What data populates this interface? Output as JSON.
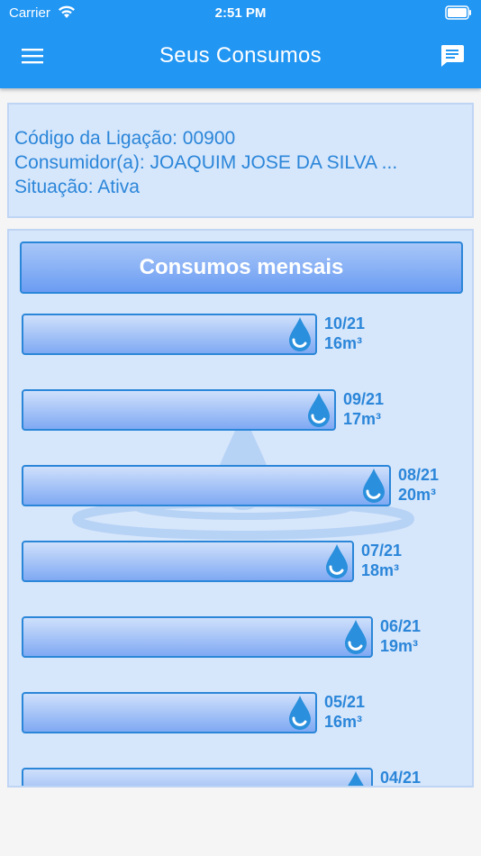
{
  "status_bar": {
    "carrier": "Carrier",
    "time": "2:51 PM"
  },
  "header": {
    "title": "Seus Consumos",
    "menu_icon": "menu-icon",
    "chat_icon": "chat-icon"
  },
  "info": {
    "codigo": "Código da Ligação: 00900",
    "consumidor": "Consumidor(a): JOAQUIM JOSE DA SILVA ...",
    "situacao": "Situação: Ativa"
  },
  "panel": {
    "title": "Consumos mensais",
    "months": [
      {
        "month": "10/21",
        "volume": "16m³",
        "value": 16
      },
      {
        "month": "09/21",
        "volume": "17m³",
        "value": 17
      },
      {
        "month": "08/21",
        "volume": "20m³",
        "value": 20
      },
      {
        "month": "07/21",
        "volume": "18m³",
        "value": 18
      },
      {
        "month": "06/21",
        "volume": "19m³",
        "value": 19
      },
      {
        "month": "05/21",
        "volume": "16m³",
        "value": 16
      },
      {
        "month": "04/21",
        "volume": "",
        "value": 19
      }
    ]
  },
  "colors": {
    "primary": "#2196f3",
    "accent_text": "#2b86d9",
    "card_bg": "#d6e6fb"
  }
}
